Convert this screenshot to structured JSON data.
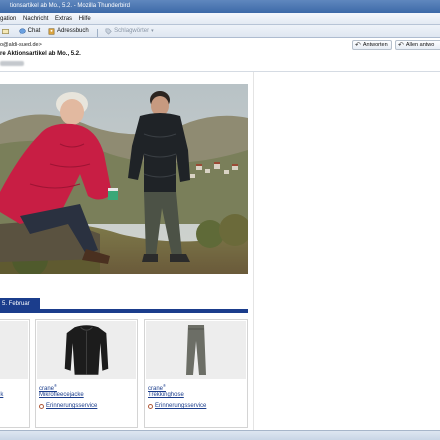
{
  "window": {
    "title": "tionsartikel ab Mo., 5.2. - Mozilla Thunderbird"
  },
  "menu": {
    "items": [
      {
        "label": "gation"
      },
      {
        "label": "Nachricht"
      },
      {
        "label": "Extras"
      },
      {
        "label": "Hilfe"
      }
    ]
  },
  "toolbar": {
    "chat": "Chat",
    "address_book": "Adressbuch",
    "tags": "Schlagwörter"
  },
  "message": {
    "from": "o@aldi-sued.de>",
    "subject": "re Aktionsartikel ab Mo., 5.2.",
    "reply": "Antworten",
    "reply_all": "Allen antwo"
  },
  "email": {
    "date_tab": "5. Februar",
    "left_card_partial_text": "ik",
    "products": [
      {
        "brand": "crane",
        "name": "Mikrofleecejacke",
        "service": "Erinnerungsservice"
      },
      {
        "brand": "crane",
        "name": "Trekkinghose",
        "service": "Erinnerungsservice"
      }
    ]
  },
  "colors": {
    "aldi_blue": "#1b3d8c",
    "jacket_red": "#c81e44",
    "titlebar": "#4a77b2"
  }
}
